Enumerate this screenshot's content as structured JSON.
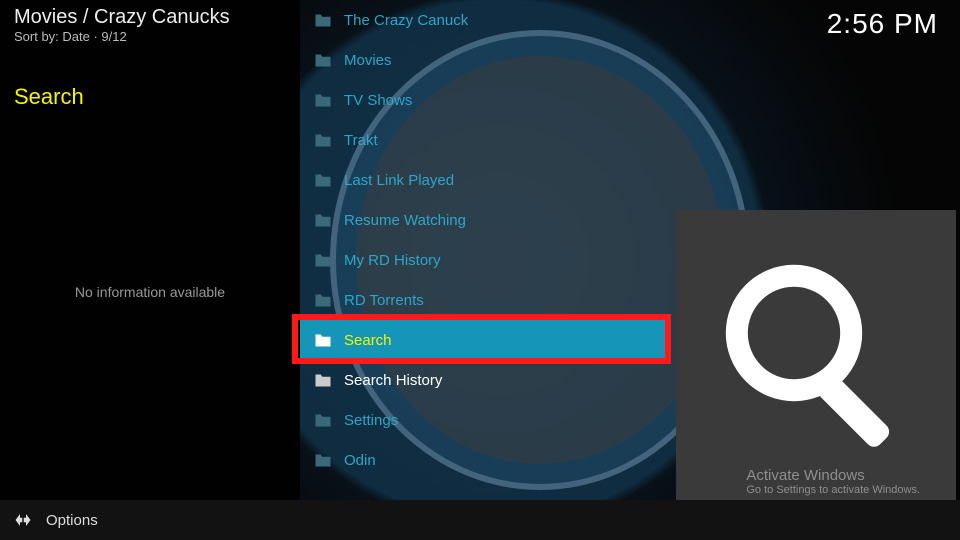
{
  "breadcrumb": "Movies / Crazy Canucks",
  "sort_line": "Sort by: Date  ·  9/12",
  "selected_title": "Search",
  "no_info": "No information available",
  "clock": "2:56 PM",
  "list": [
    {
      "label": "The Crazy Canuck",
      "style": "default"
    },
    {
      "label": "Movies",
      "style": "default"
    },
    {
      "label": "TV Shows",
      "style": "default"
    },
    {
      "label": "Trakt",
      "style": "default"
    },
    {
      "label": "Last Link Played",
      "style": "default"
    },
    {
      "label": "Resume Watching",
      "style": "default"
    },
    {
      "label": "My RD History",
      "style": "default"
    },
    {
      "label": "RD Torrents",
      "style": "default"
    },
    {
      "label": "Search",
      "style": "selected"
    },
    {
      "label": "Search History",
      "style": "white"
    },
    {
      "label": "Settings",
      "style": "default"
    },
    {
      "label": "Odin",
      "style": "default"
    }
  ],
  "highlight_index": 8,
  "options_label": "Options",
  "activate": {
    "line1": "Activate Windows",
    "line2": "Go to Settings to activate Windows."
  }
}
